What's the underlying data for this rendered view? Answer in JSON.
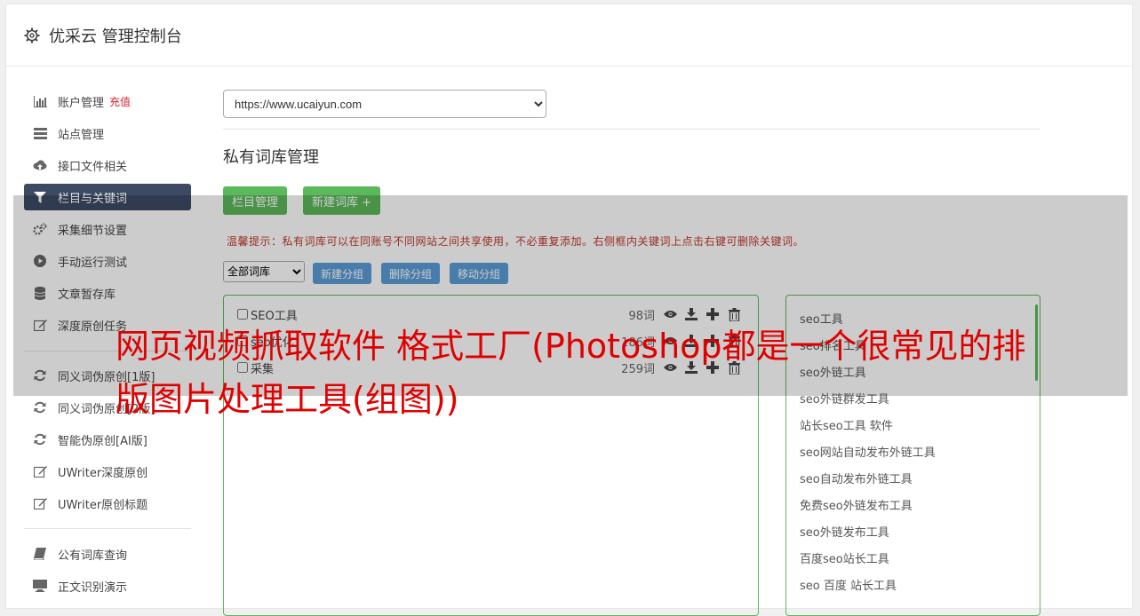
{
  "header": {
    "title": "优采云 管理控制台",
    "icon": "gear-icon"
  },
  "sidebar": {
    "items": [
      {
        "label": "账户管理",
        "badge": "充值",
        "icon": "bar-chart-icon"
      },
      {
        "label": "站点管理",
        "icon": "server-icon"
      },
      {
        "label": "接口文件相关",
        "icon": "cloud-upload-icon"
      },
      {
        "label": "栏目与关键词",
        "icon": "filter-icon",
        "active": true
      },
      {
        "label": "采集细节设置",
        "icon": "cogs-icon"
      },
      {
        "label": "手动运行测试",
        "icon": "play-circle-icon"
      },
      {
        "label": "文章暂存库",
        "icon": "database-icon"
      },
      {
        "label": "深度原创任务",
        "icon": "edit-icon"
      },
      {
        "label": "同义词伪原创[1版]",
        "icon": "refresh-icon"
      },
      {
        "label": "同义词伪原创[2版]",
        "icon": "refresh-icon"
      },
      {
        "label": "智能伪原创[AI版]",
        "icon": "refresh-icon"
      },
      {
        "label": "UWriter深度原创",
        "icon": "edit-icon"
      },
      {
        "label": "UWriter原创标题",
        "icon": "edit-icon"
      },
      {
        "label": "公有词库查询",
        "icon": "book-icon"
      },
      {
        "label": "正文识别演示",
        "icon": "monitor-icon"
      }
    ]
  },
  "main": {
    "site_select": "https://www.ucaiyun.com",
    "section_title": "私有词库管理",
    "btn_column": "栏目管理",
    "btn_new_lib": "新建词库 +",
    "tip": "温馨提示：私有词库可以在同账号不同网站之间共享使用，不必重复添加。右侧框内关键词上点击右键可删除关键词。",
    "filter_select": "全部词库",
    "btn_new_group": "新建分组",
    "btn_delete_group": "删除分组",
    "btn_move_group": "移动分组",
    "libraries": [
      {
        "name": "SEO工具",
        "count": "98词"
      },
      {
        "name": "seo优化",
        "count": "186词"
      },
      {
        "name": "采集",
        "count": "259词"
      }
    ],
    "keywords": [
      "seo工具",
      "seo排名工具",
      "seo外链工具",
      "seo外链群发工具",
      "站长seo工具 软件",
      "seo网站自动发布外链工具",
      "seo自动发布外链工具",
      "免费seo外链发布工具",
      "seo外链发布工具",
      "百度seo站长工具",
      "seo 百度 站长工具"
    ]
  },
  "overlay": {
    "headline": "网页视频抓取软件 格式工厂(Photoshop都是一个很常见的排版图片处理工具(组图))"
  },
  "colors": {
    "accent_green": "#5cb85c",
    "accent_blue": "#5b9bd5",
    "active_nav": "#3c4a63",
    "headline_red": "#e00000",
    "tip_red": "#c0392b"
  }
}
